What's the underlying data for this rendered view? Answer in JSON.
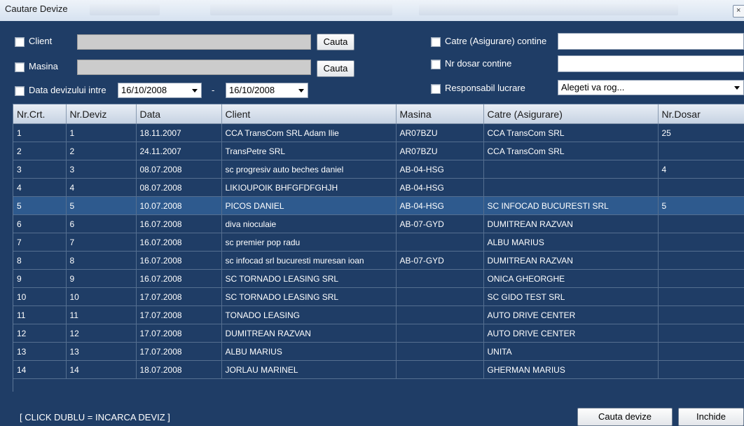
{
  "window": {
    "title": "Cautare Devize",
    "close_glyph": "×"
  },
  "filters": {
    "client_label": "Client",
    "client_search_button": "Cauta",
    "masina_label": "Masina",
    "masina_search_button": "Cauta",
    "date_label": "Data devizului intre",
    "date_from": "16/10/2008",
    "date_separator": "-",
    "date_to": "16/10/2008",
    "catre_label": "Catre (Asigurare) contine",
    "catre_value": "",
    "dosar_label": "Nr dosar contine",
    "dosar_value": "",
    "responsabil_label": "Responsabil lucrare",
    "responsabil_selected": "Alegeti va rog..."
  },
  "table": {
    "columns": [
      "Nr.Crt.",
      "Nr.Deviz",
      "Data",
      "Client",
      "Masina",
      "Catre (Asigurare)",
      "Nr.Dosar"
    ],
    "selected_row": 4,
    "rows": [
      [
        "1",
        "1",
        "18.11.2007",
        "CCA TransCom SRL Adam Ilie",
        "AR07BZU",
        "CCA TransCom SRL",
        "25"
      ],
      [
        "2",
        "2",
        "24.11.2007",
        "TransPetre SRL",
        "AR07BZU",
        "CCA TransCom SRL",
        ""
      ],
      [
        "3",
        "3",
        "08.07.2008",
        "sc progresiv auto beches daniel",
        "AB-04-HSG",
        "",
        "4"
      ],
      [
        "4",
        "4",
        "08.07.2008",
        "LIKIOUPOIK BHFGFDFGHJH",
        "AB-04-HSG",
        "",
        ""
      ],
      [
        "5",
        "5",
        "10.07.2008",
        " PICOS DANIEL",
        "AB-04-HSG",
        "SC INFOCAD BUCURESTI SRL",
        "5"
      ],
      [
        "6",
        "6",
        "16.07.2008",
        " diva nioculaie",
        "AB-07-GYD",
        "DUMITREAN RAZVAN",
        ""
      ],
      [
        "7",
        "7",
        "16.07.2008",
        "sc premier pop radu",
        "",
        "ALBU MARIUS",
        ""
      ],
      [
        "8",
        "8",
        "16.07.2008",
        "sc infocad srl bucuresti muresan ioan",
        "AB-07-GYD",
        "DUMITREAN RAZVAN",
        ""
      ],
      [
        "9",
        "9",
        "16.07.2008",
        "SC TORNADO LEASING SRL",
        "",
        "ONICA GHEORGHE",
        ""
      ],
      [
        "10",
        "10",
        "17.07.2008",
        " SC TORNADO LEASING SRL",
        "",
        "SC GIDO TEST SRL",
        ""
      ],
      [
        "11",
        "11",
        "17.07.2008",
        " TONADO LEASING",
        "",
        "AUTO DRIVE CENTER",
        ""
      ],
      [
        "12",
        "12",
        "17.07.2008",
        " DUMITREAN RAZVAN",
        "",
        "AUTO DRIVE CENTER",
        ""
      ],
      [
        "13",
        "13",
        "17.07.2008",
        " ALBU MARIUS",
        "",
        "UNITA",
        ""
      ],
      [
        "14",
        "14",
        "18.07.2008",
        " JORLAU MARINEL",
        "",
        "GHERMAN MARIUS",
        ""
      ]
    ]
  },
  "footer": {
    "hint": "[ CLICK DUBLU = INCARCA DEVIZ ]",
    "search_button": "Cauta devize",
    "close_button": "Inchide"
  }
}
